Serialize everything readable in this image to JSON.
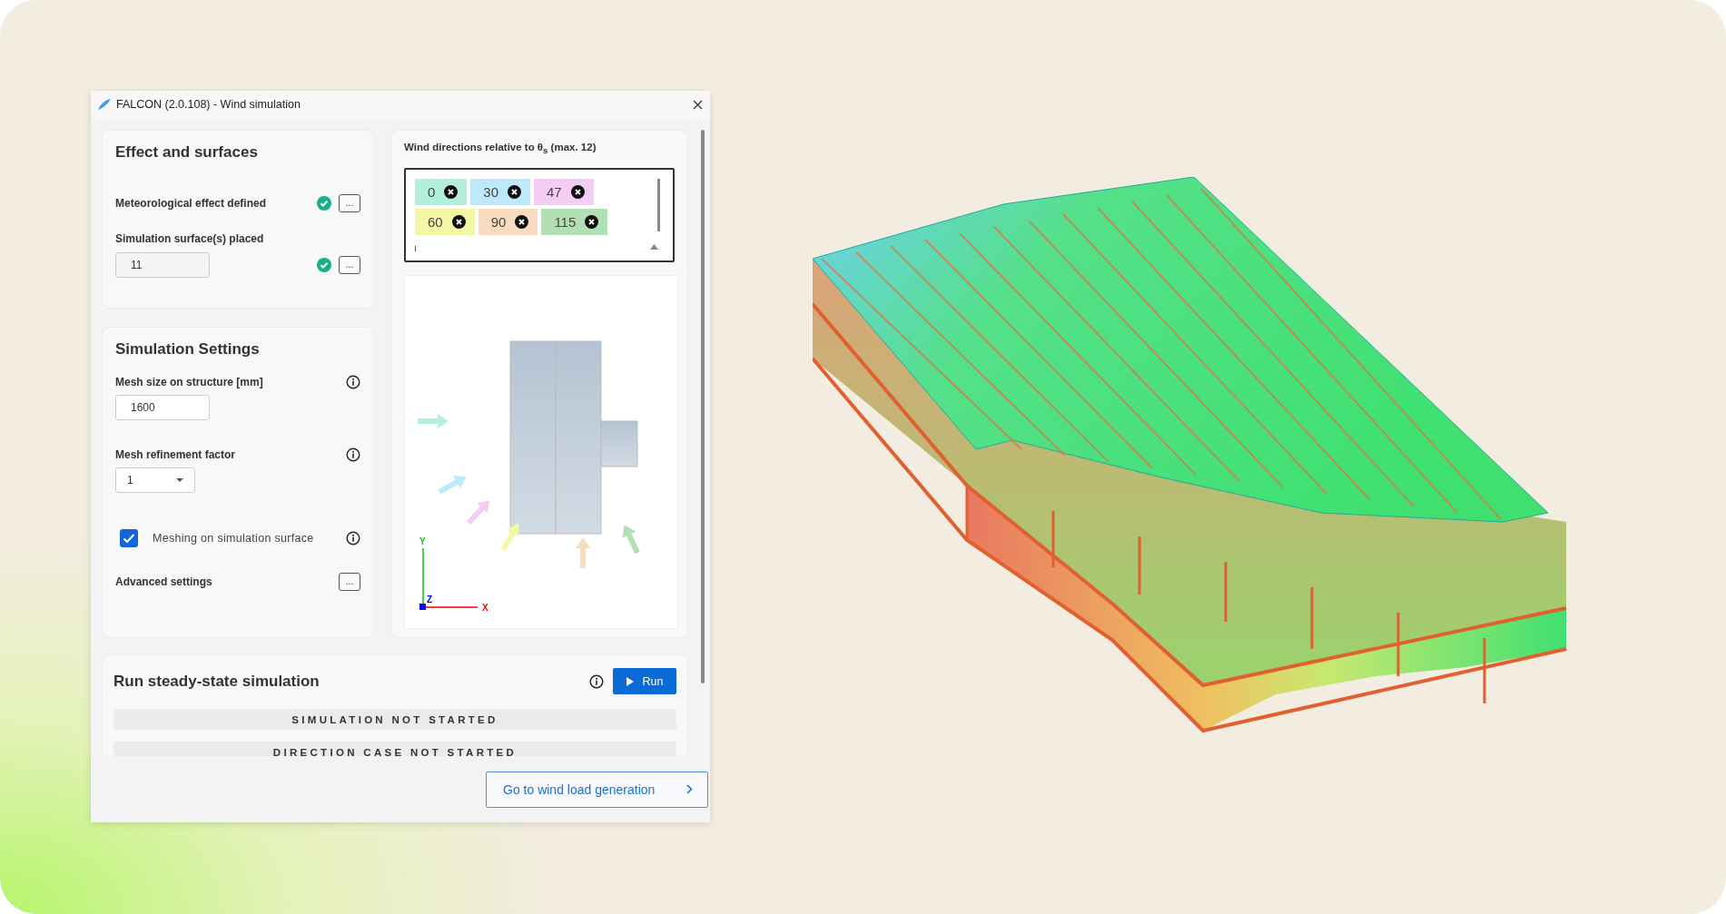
{
  "window": {
    "title": "FALCON (2.0.108) - Wind simulation"
  },
  "effect_and_surfaces": {
    "title": "Effect and surfaces",
    "items": [
      {
        "label": "Meteorological effect defined",
        "done": true,
        "action": "..."
      },
      {
        "label": "Simulation surface(s) placed",
        "value": "11",
        "done": true,
        "action": "..."
      }
    ]
  },
  "simulation_settings": {
    "title": "Simulation Settings",
    "mesh_size": {
      "label": "Mesh size on structure [mm]",
      "value": "1600"
    },
    "refinement": {
      "label": "Mesh refinement factor",
      "value": "1"
    },
    "meshing_on_surface": {
      "label": "Meshing on simulation surface",
      "checked": true
    },
    "advanced": {
      "label": "Advanced settings",
      "action": "..."
    }
  },
  "wind_directions": {
    "title": "Wind directions relative to θ$_{s}$ (max. 12)",
    "tags": [
      {
        "label": "0",
        "color": "#b2f0dc"
      },
      {
        "label": "30",
        "color": "#bde9fb"
      },
      {
        "label": "47",
        "color": "#f3cdf3"
      },
      {
        "label": "60",
        "color": "#f3f7a6"
      },
      {
        "label": "90",
        "color": "#f8dcc0"
      },
      {
        "label": "115",
        "color": "#b3dfb5"
      }
    ],
    "axes": {
      "x": "X",
      "y": "Y",
      "z": "Z"
    }
  },
  "run": {
    "title": "Run steady-state simulation",
    "button": "Run",
    "statuses": [
      "SIMULATION NOT STARTED",
      "DIRECTION CASE NOT STARTED"
    ]
  },
  "footer": {
    "button": "Go to wind load generation"
  }
}
